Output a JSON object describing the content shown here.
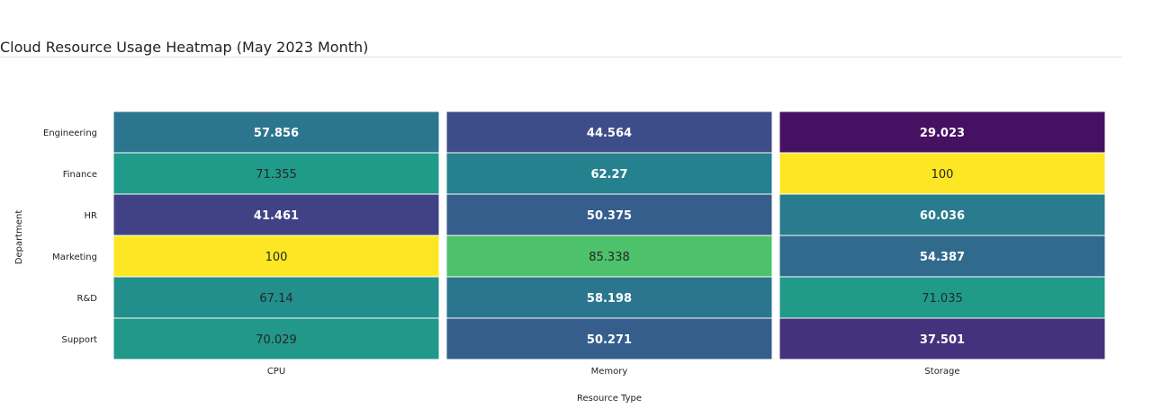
{
  "title": "Cloud Resource Usage Heatmap (May 2023 Month)",
  "chart_data": {
    "type": "heatmap",
    "xlabel": "Resource Type",
    "ylabel": "Department",
    "columns": [
      "CPU",
      "Memory",
      "Storage"
    ],
    "rows": [
      "Engineering",
      "Finance",
      "HR",
      "Marketing",
      "R&D",
      "Support"
    ],
    "values": [
      [
        57.856,
        44.564,
        29.023
      ],
      [
        71.355,
        62.27,
        100
      ],
      [
        41.461,
        50.375,
        60.036
      ],
      [
        100,
        85.338,
        54.387
      ],
      [
        67.14,
        58.198,
        71.035
      ],
      [
        70.029,
        50.271,
        37.501
      ]
    ],
    "color_scale": "viridis",
    "grid": false
  }
}
